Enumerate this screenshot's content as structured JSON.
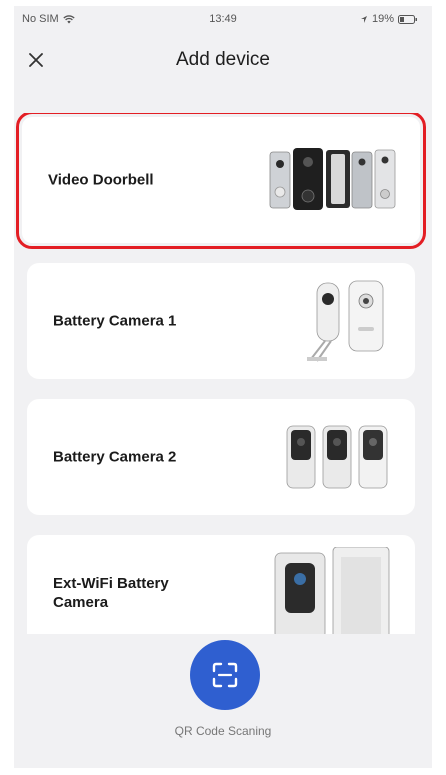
{
  "status_bar": {
    "carrier": "No SIM",
    "time": "13:49",
    "battery": "19%",
    "icons": [
      "wifi-icon",
      "location-icon",
      "battery-icon"
    ]
  },
  "header": {
    "title": "Add device",
    "close_icon": "close-icon"
  },
  "devices": [
    {
      "label": "Video Doorbell",
      "selected": true,
      "image": "video-doorbell-image"
    },
    {
      "label": "Battery Camera 1",
      "selected": false,
      "image": "battery-camera-image"
    },
    {
      "label": "Battery Camera 2",
      "selected": false,
      "image": "battery-camera-image"
    },
    {
      "label": "Ext-WiFi Battery Camera",
      "selected": false,
      "image": "ext-wifi-camera-image"
    }
  ],
  "qr": {
    "label": "QR Code Scaning",
    "icon": "scan-icon"
  },
  "colors": {
    "accent": "#2f5fd0",
    "highlight": "#e31e24",
    "background": "#f1f1f3",
    "card": "#ffffff"
  }
}
